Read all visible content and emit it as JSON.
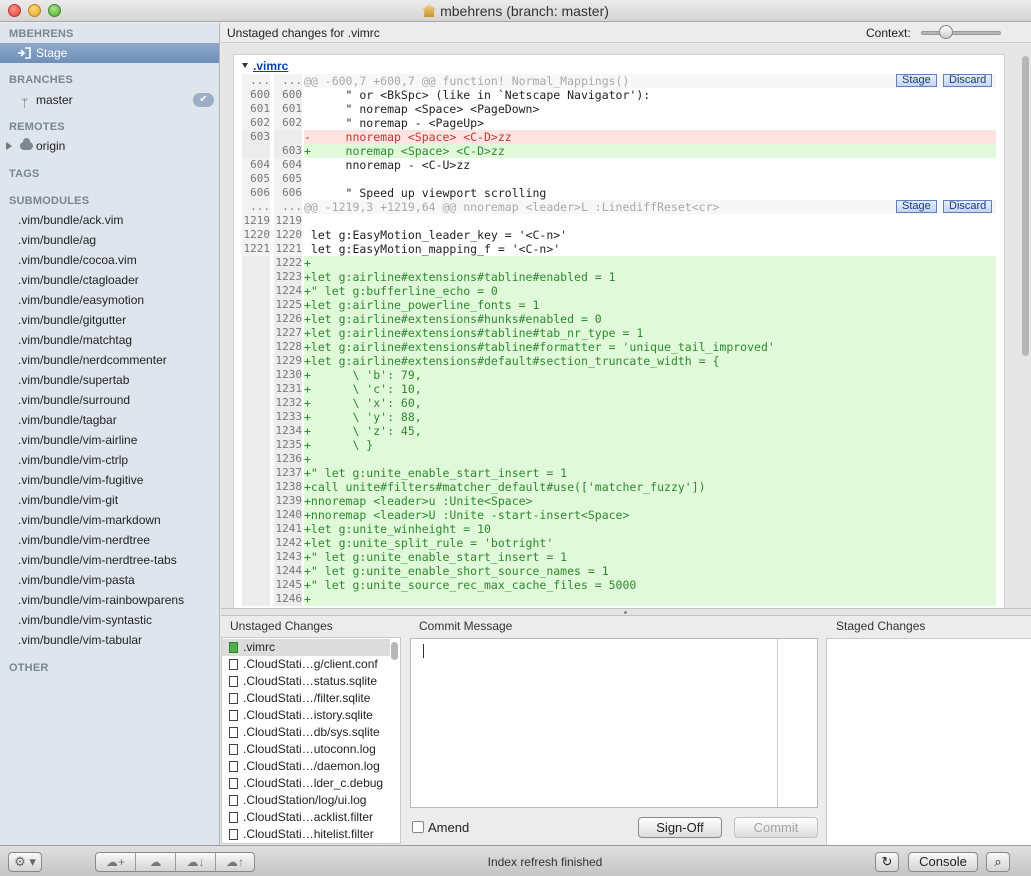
{
  "window": {
    "title": "mbehrens (branch: master)"
  },
  "sidebar": {
    "headers": {
      "repo": "MBEHRENS",
      "branches": "BRANCHES",
      "remotes": "REMOTES",
      "tags": "TAGS",
      "submodules": "SUBMODULES",
      "other": "OTHER"
    },
    "stage_label": "Stage",
    "branch_label": "master",
    "branch_badge": "✔",
    "remote_label": "origin",
    "submodules": [
      ".vim/bundle/ack.vim",
      ".vim/bundle/ag",
      ".vim/bundle/cocoa.vim",
      ".vim/bundle/ctagloader",
      ".vim/bundle/easymotion",
      ".vim/bundle/gitgutter",
      ".vim/bundle/matchtag",
      ".vim/bundle/nerdcommenter",
      ".vim/bundle/supertab",
      ".vim/bundle/surround",
      ".vim/bundle/tagbar",
      ".vim/bundle/vim-airline",
      ".vim/bundle/vim-ctrlp",
      ".vim/bundle/vim-fugitive",
      ".vim/bundle/vim-git",
      ".vim/bundle/vim-markdown",
      ".vim/bundle/vim-nerdtree",
      ".vim/bundle/vim-nerdtree-tabs",
      ".vim/bundle/vim-pasta",
      ".vim/bundle/vim-rainbowparens",
      ".vim/bundle/vim-syntastic",
      ".vim/bundle/vim-tabular"
    ]
  },
  "diff": {
    "header": "Unstaged changes for .vimrc",
    "context_label": "Context:",
    "file_name": ".vimrc",
    "stage_button": "Stage",
    "discard_button": "Discard",
    "lines": [
      {
        "type": "hunk",
        "a": "...",
        "b": "...",
        "text": "@@ -600,7 +600,7 @@ function! Normal_Mappings()"
      },
      {
        "type": "ctx",
        "a": "600",
        "b": "600",
        "text": "      \" or <BkSpc> (like in `Netscape Navigator'):"
      },
      {
        "type": "ctx",
        "a": "601",
        "b": "601",
        "text": "      \" noremap <Space> <PageDown>"
      },
      {
        "type": "ctx",
        "a": "602",
        "b": "602",
        "text": "      \" noremap - <PageUp>"
      },
      {
        "type": "del",
        "a": "603",
        "b": "",
        "text": "-     nnoremap <Space> <C-D>zz"
      },
      {
        "type": "add",
        "a": "",
        "b": "603",
        "text": "+     noremap <Space> <C-D>zz"
      },
      {
        "type": "ctx",
        "a": "604",
        "b": "604",
        "text": "      nnoremap - <C-U>zz"
      },
      {
        "type": "ctx",
        "a": "605",
        "b": "605",
        "text": ""
      },
      {
        "type": "ctx",
        "a": "606",
        "b": "606",
        "text": "      \" Speed up viewport scrolling"
      },
      {
        "type": "hunk",
        "a": "...",
        "b": "...",
        "text": "@@ -1219,3 +1219,64 @@ nnoremap <leader>L :LinediffReset<cr>"
      },
      {
        "type": "ctx",
        "a": "1219",
        "b": "1219",
        "text": ""
      },
      {
        "type": "ctx",
        "a": "1220",
        "b": "1220",
        "text": " let g:EasyMotion_leader_key = '<C-n>'"
      },
      {
        "type": "ctx",
        "a": "1221",
        "b": "1221",
        "text": " let g:EasyMotion_mapping_f = '<C-n>'"
      },
      {
        "type": "add",
        "a": "",
        "b": "1222",
        "text": "+"
      },
      {
        "type": "add",
        "a": "",
        "b": "1223",
        "text": "+let g:airline#extensions#tabline#enabled = 1"
      },
      {
        "type": "add",
        "a": "",
        "b": "1224",
        "text": "+\" let g:bufferline_echo = 0"
      },
      {
        "type": "add",
        "a": "",
        "b": "1225",
        "text": "+let g:airline_powerline_fonts = 1"
      },
      {
        "type": "add",
        "a": "",
        "b": "1226",
        "text": "+let g:airline#extensions#hunks#enabled = 0"
      },
      {
        "type": "add",
        "a": "",
        "b": "1227",
        "text": "+let g:airline#extensions#tabline#tab_nr_type = 1"
      },
      {
        "type": "add",
        "a": "",
        "b": "1228",
        "text": "+let g:airline#extensions#tabline#formatter = 'unique_tail_improved'"
      },
      {
        "type": "add",
        "a": "",
        "b": "1229",
        "text": "+let g:airline#extensions#default#section_truncate_width = {"
      },
      {
        "type": "add",
        "a": "",
        "b": "1230",
        "text": "+      \\ 'b': 79,"
      },
      {
        "type": "add",
        "a": "",
        "b": "1231",
        "text": "+      \\ 'c': 10,"
      },
      {
        "type": "add",
        "a": "",
        "b": "1232",
        "text": "+      \\ 'x': 60,"
      },
      {
        "type": "add",
        "a": "",
        "b": "1233",
        "text": "+      \\ 'y': 88,"
      },
      {
        "type": "add",
        "a": "",
        "b": "1234",
        "text": "+      \\ 'z': 45,"
      },
      {
        "type": "add",
        "a": "",
        "b": "1235",
        "text": "+      \\ }"
      },
      {
        "type": "add",
        "a": "",
        "b": "1236",
        "text": "+"
      },
      {
        "type": "add",
        "a": "",
        "b": "1237",
        "text": "+\" let g:unite_enable_start_insert = 1"
      },
      {
        "type": "add",
        "a": "",
        "b": "1238",
        "text": "+call unite#filters#matcher_default#use(['matcher_fuzzy'])"
      },
      {
        "type": "add",
        "a": "",
        "b": "1239",
        "text": "+nnoremap <leader>u :Unite<Space>"
      },
      {
        "type": "add",
        "a": "",
        "b": "1240",
        "text": "+nnoremap <leader>U :Unite -start-insert<Space>"
      },
      {
        "type": "add",
        "a": "",
        "b": "1241",
        "text": "+let g:unite_winheight = 10"
      },
      {
        "type": "add",
        "a": "",
        "b": "1242",
        "text": "+let g:unite_split_rule = 'botright'"
      },
      {
        "type": "add",
        "a": "",
        "b": "1243",
        "text": "+\" let g:unite_enable_start_insert = 1"
      },
      {
        "type": "add",
        "a": "",
        "b": "1244",
        "text": "+\" let g:unite_enable_short_source_names = 1"
      },
      {
        "type": "add",
        "a": "",
        "b": "1245",
        "text": "+\" let g:unite_source_rec_max_cache_files = 5000"
      },
      {
        "type": "add",
        "a": "",
        "b": "1246",
        "text": "+"
      }
    ]
  },
  "bottom": {
    "unstaged_label": "Unstaged Changes",
    "commit_label": "Commit Message",
    "staged_label": "Staged Changes",
    "unstaged_files": [
      ".vimrc",
      ".CloudStati…g/client.conf",
      ".CloudStati…status.sqlite",
      ".CloudStati…/filter.sqlite",
      ".CloudStati…istory.sqlite",
      ".CloudStati…db/sys.sqlite",
      ".CloudStati…utoconn.log",
      ".CloudStati…/daemon.log",
      ".CloudStati…lder_c.debug",
      ".CloudStation/log/ui.log",
      ".CloudStati…acklist.filter",
      ".CloudStati…hitelist.filter"
    ],
    "amend_label": "Amend",
    "signoff_button": "Sign-Off",
    "commit_button": "Commit"
  },
  "statusbar": {
    "status_text": "Index refresh finished",
    "console_button": "Console"
  }
}
